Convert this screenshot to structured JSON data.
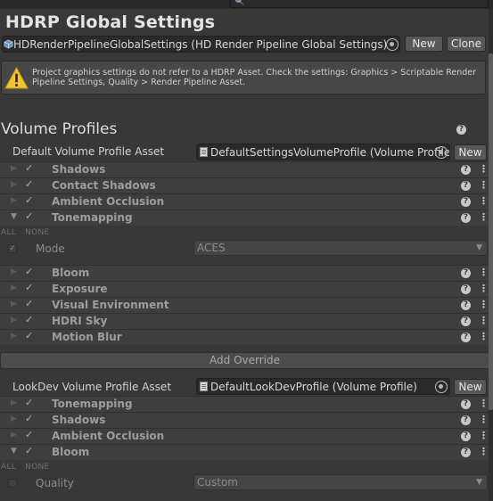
{
  "window": {
    "title": "HDRP Global Settings",
    "search": {
      "icon": "search-icon",
      "placeholder": ""
    }
  },
  "settings_asset": {
    "value": "HDRenderPipelineGlobalSettings (HD Render Pipeline Global Settings)",
    "new_label": "New",
    "clone_label": "Clone"
  },
  "warning": {
    "icon": "warning-icon",
    "message": "Project graphics settings do not refer to a HDRP Asset. Check the settings: Graphics > Scriptable Render Pipeline Settings, Quality > Render Pipeline Asset."
  },
  "volume_profiles": {
    "title": "Volume Profiles",
    "default": {
      "label": "Default Volume Profile Asset",
      "value": "DefaultSettingsVolumeProfile (Volume Profile)",
      "new_label": "New",
      "components": [
        {
          "label": "Shadows",
          "enabled": true
        },
        {
          "label": "Contact Shadows",
          "enabled": true
        },
        {
          "label": "Ambient Occlusion",
          "enabled": true
        },
        {
          "label": "Tonemapping",
          "enabled": true,
          "expanded": true
        },
        {
          "label": "Bloom",
          "enabled": true
        },
        {
          "label": "Exposure",
          "enabled": true
        },
        {
          "label": "Visual Environment",
          "enabled": true
        },
        {
          "label": "HDRI Sky",
          "enabled": true
        },
        {
          "label": "Motion Blur",
          "enabled": true
        }
      ],
      "expanded_panel": {
        "all_label": "ALL",
        "none_label": "NONE",
        "property_label": "Mode",
        "property_value": "ACES",
        "override_checked": true
      },
      "add_override_label": "Add Override"
    },
    "lookdev": {
      "label": "LookDev Volume Profile Asset",
      "value": "DefaultLookDevProfile (Volume Profile)",
      "new_label": "New",
      "components": [
        {
          "label": "Tonemapping",
          "enabled": true
        },
        {
          "label": "Shadows",
          "enabled": true
        },
        {
          "label": "Ambient Occlusion",
          "enabled": true
        },
        {
          "label": "Bloom",
          "enabled": true,
          "expanded": true
        }
      ],
      "expanded_panel": {
        "all_label": "ALL",
        "none_label": "NONE",
        "property_label": "Quality",
        "property_value": "Custom",
        "override_checked": false
      }
    }
  },
  "colors": {
    "background": "#383838",
    "row": "#3e3e3e",
    "field": "#2a2a2a",
    "button": "#585858",
    "warning_yellow": "#f1c232"
  }
}
